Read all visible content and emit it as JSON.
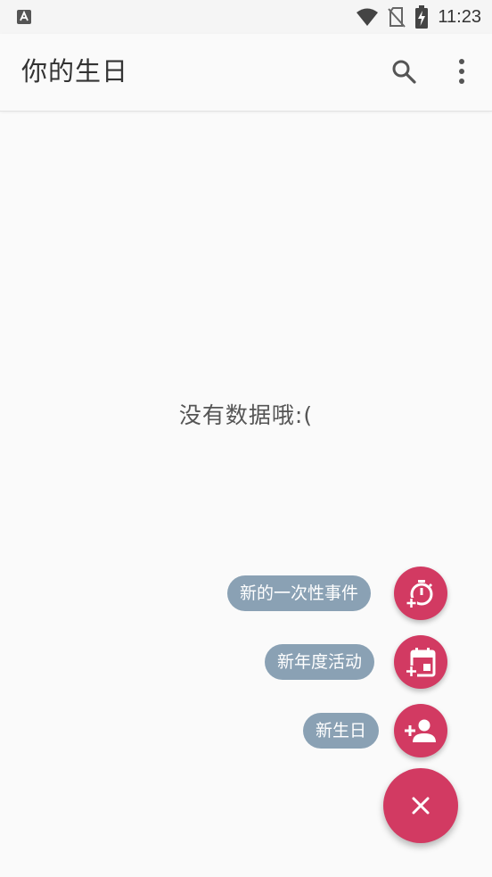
{
  "status_bar": {
    "time": "11:23",
    "icons": [
      "keyboard-a-icon",
      "wifi-icon",
      "no-sim-icon",
      "battery-charging-icon"
    ]
  },
  "app_bar": {
    "title": "你的生日",
    "actions": [
      "search-icon",
      "more-vert-icon"
    ]
  },
  "empty_state": {
    "message": "没有数据哦:("
  },
  "speed_dial": {
    "items": [
      {
        "label": "新的一次性事件",
        "icon": "add-timer-icon"
      },
      {
        "label": "新年度活动",
        "icon": "add-calendar-icon"
      },
      {
        "label": "新生日",
        "icon": "add-person-icon"
      }
    ],
    "main_icon": "close-icon"
  },
  "colors": {
    "accent": "#d23a62",
    "label_bg": "#8aa1b4",
    "background": "#fafafa"
  }
}
